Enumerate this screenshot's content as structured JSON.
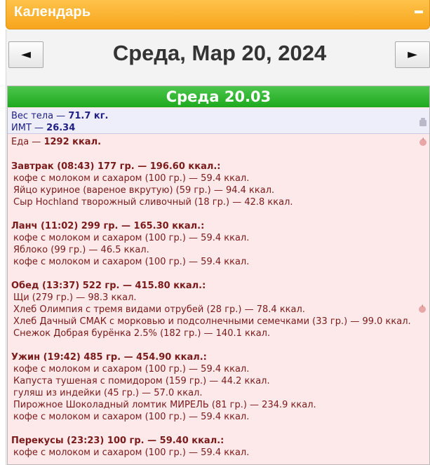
{
  "panel": {
    "title": "Календарь"
  },
  "nav": {
    "prev": "◄",
    "next": "►",
    "date_title": "Среда, Мар 20, 2024"
  },
  "day": {
    "header": "Среда 20.03",
    "weight_label": "Вес тела — ",
    "weight_value": "71.7 кг.",
    "bmi_label": "ИМТ — ",
    "bmi_value": "26.34",
    "food_label": "Еда — ",
    "food_value": "1292 ккал."
  },
  "meals": [
    {
      "title": "Завтрак (08:43) 177 гр. — 196.60 ккал.:",
      "items": [
        "кофе с молоком и сахаром (100 гр.) — 59.4 ккал.",
        "Яйцо куриное (вареное вкрутую) (59 гр.) — 94.4 ккал.",
        "Сыр Hochland творожный сливочный (18 гр.) — 42.8 ккал."
      ]
    },
    {
      "title": "Ланч (11:02) 299 гр. — 165.30 ккал.:",
      "items": [
        "кофе с молоком и сахаром (100 гр.) — 59.4 ккал.",
        "Яблоко (99 гр.) — 46.5 ккал.",
        "кофе с молоком и сахаром (100 гр.) — 59.4 ккал."
      ]
    },
    {
      "title": "Обед (13:37) 522 гр. — 415.80 ккал.:",
      "items": [
        "Щи (279 гр.) — 98.3 ккал.",
        "Хлеб Олимпия с тремя видами отрубей (28 гр.) — 78.4 ккал.",
        "Хлеб Дачный СМАК с морковью и подсолнечными семечками (33 гр.) — 99.0 ккал.",
        "Снежок Добрая бурёнка 2.5% (182 гр.) — 140.1 ккал."
      ]
    },
    {
      "title": "Ужин (19:42) 485 гр. — 454.90 ккал.:",
      "items": [
        "кофе с молоком и сахаром (100 гр.) — 59.4 ккал.",
        "Капуста тушеная с помидором (159 гр.) — 44.2 ккал.",
        "гуляш из индейки (45 гр.) — 57.0 ккал.",
        "Пирожное Шоколадный ломтик МИРЕЛЬ (81 гр.) — 234.9 ккал.",
        "кофе с молоком и сахаром (100 гр.) — 59.4 ккал."
      ]
    },
    {
      "title": "Перекусы (23:23) 100 гр. — 59.40 ккал.:",
      "items": [
        "кофе с молоком и сахаром (100 гр.) — 59.4 ккал."
      ]
    }
  ]
}
